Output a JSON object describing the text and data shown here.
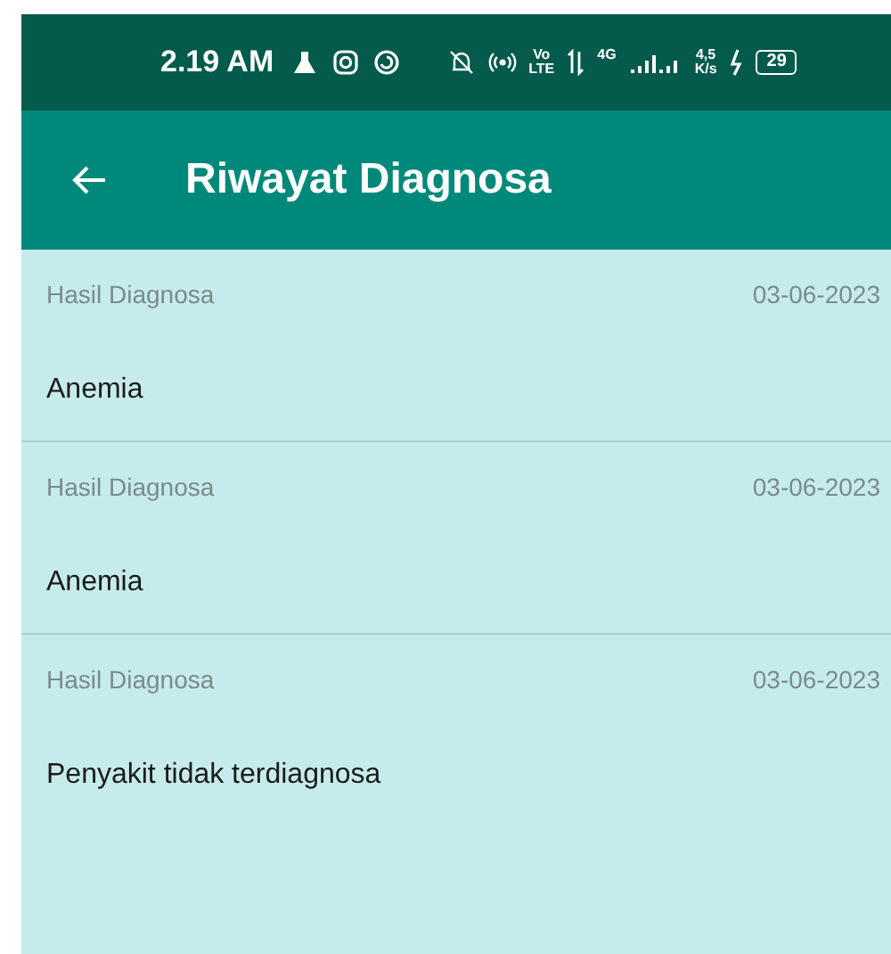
{
  "status_bar": {
    "time": "2.19 AM",
    "volte_top": "Vo",
    "volte_bottom": "LTE",
    "network": "4G",
    "speed_value": "4,5",
    "speed_unit": "K/s",
    "battery": "29"
  },
  "app_bar": {
    "title": "Riwayat Diagnosa"
  },
  "history": [
    {
      "label": "Hasil Diagnosa",
      "date": "03-06-2023",
      "result": "Anemia"
    },
    {
      "label": "Hasil Diagnosa",
      "date": "03-06-2023",
      "result": "Anemia"
    },
    {
      "label": "Hasil Diagnosa",
      "date": "03-06-2023",
      "result": "Penyakit tidak terdiagnosa"
    }
  ]
}
